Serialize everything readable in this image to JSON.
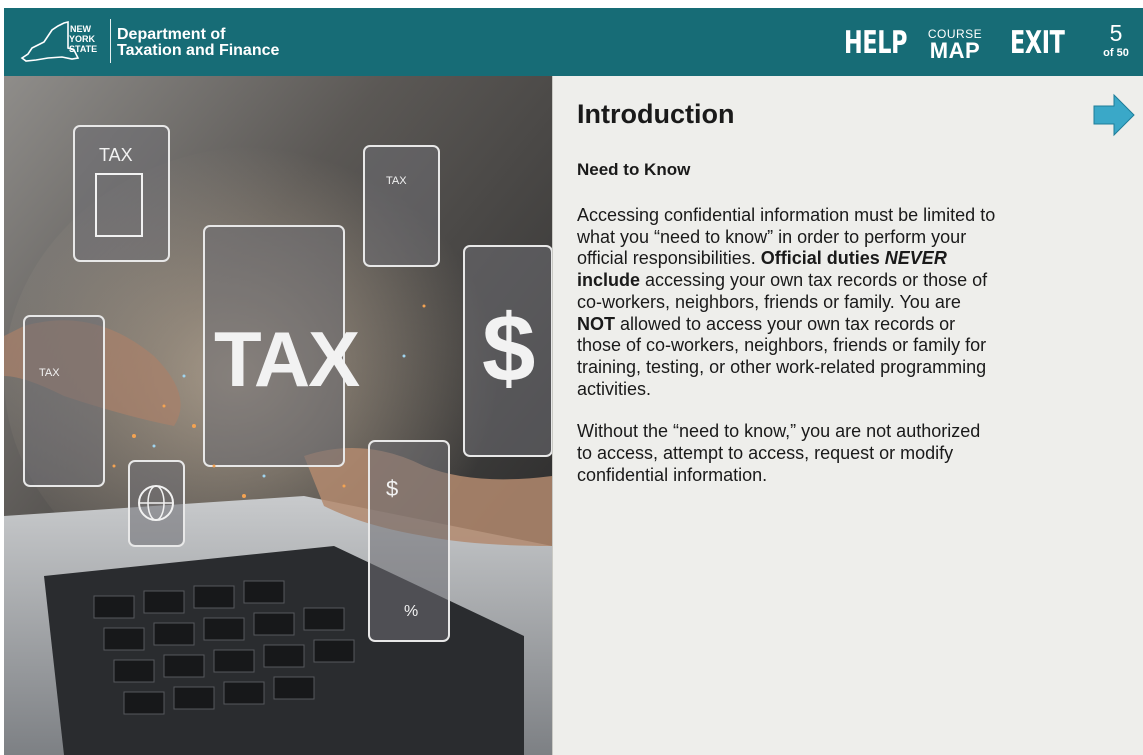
{
  "header": {
    "logo_lines": [
      "NEW",
      "YORK",
      "STATE"
    ],
    "department_line1": "Department of",
    "department_line2": "Taxation and Finance",
    "help_label": "HELP",
    "course_label": "COURSE",
    "map_label": "MAP",
    "exit_label": "EXIT",
    "page_number": "5",
    "page_total": "of 50"
  },
  "hero": {
    "badges": [
      "TAX",
      "TAX",
      "TAX",
      "TAX",
      "$",
      "$",
      "%"
    ]
  },
  "content": {
    "title": "Introduction",
    "subtitle": "Need to Know",
    "p1": [
      "Accessing confidential information must be limited to what you “need to know” in order to perform your official responsibilities. ",
      "Official duties ",
      "NEVER",
      " include",
      " accessing your own tax records or those of co-workers, neighbors, friends or family. You are ",
      "NOT",
      " allowed to access your own tax records or those of co-workers, neighbors, friends or family for training, testing, or other work-related programming activities."
    ],
    "p2": "Without the “need to know,” you are not authorized to access, attempt to access, request or modify confidential information."
  },
  "colors": {
    "header_bg": "#176c76",
    "pane_bg": "#eeeeeb",
    "next_arrow": "#3aa8c8"
  },
  "icons": {
    "next": "next-arrow-icon"
  }
}
